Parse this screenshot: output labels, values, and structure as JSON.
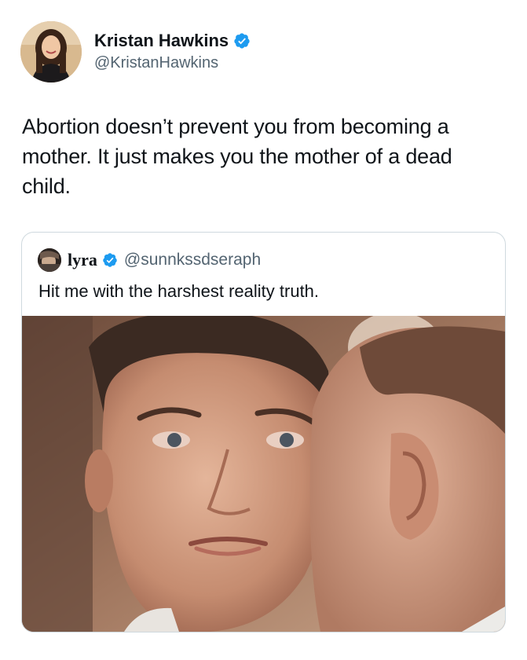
{
  "tweet": {
    "author": {
      "name": "Kristan Hawkins",
      "handle": "@KristanHawkins",
      "verified_icon": "verified-badge-icon",
      "avatar": "avatar-photo"
    },
    "text": "Abortion doesn’t prevent you from becoming a mother. It just makes you the mother of a dead child."
  },
  "quoted_tweet": {
    "author": {
      "name": "lyra",
      "handle": "@sunnkssdseraph",
      "verified_icon": "verified-badge-icon",
      "avatar": "avatar-photo"
    },
    "text": "Hit me with the harshest reality truth.",
    "media": "photo-man-whispering-in-ear"
  },
  "colors": {
    "verified_blue": "#1d9bf0",
    "secondary_text": "#536471",
    "border": "#cfd9de"
  }
}
